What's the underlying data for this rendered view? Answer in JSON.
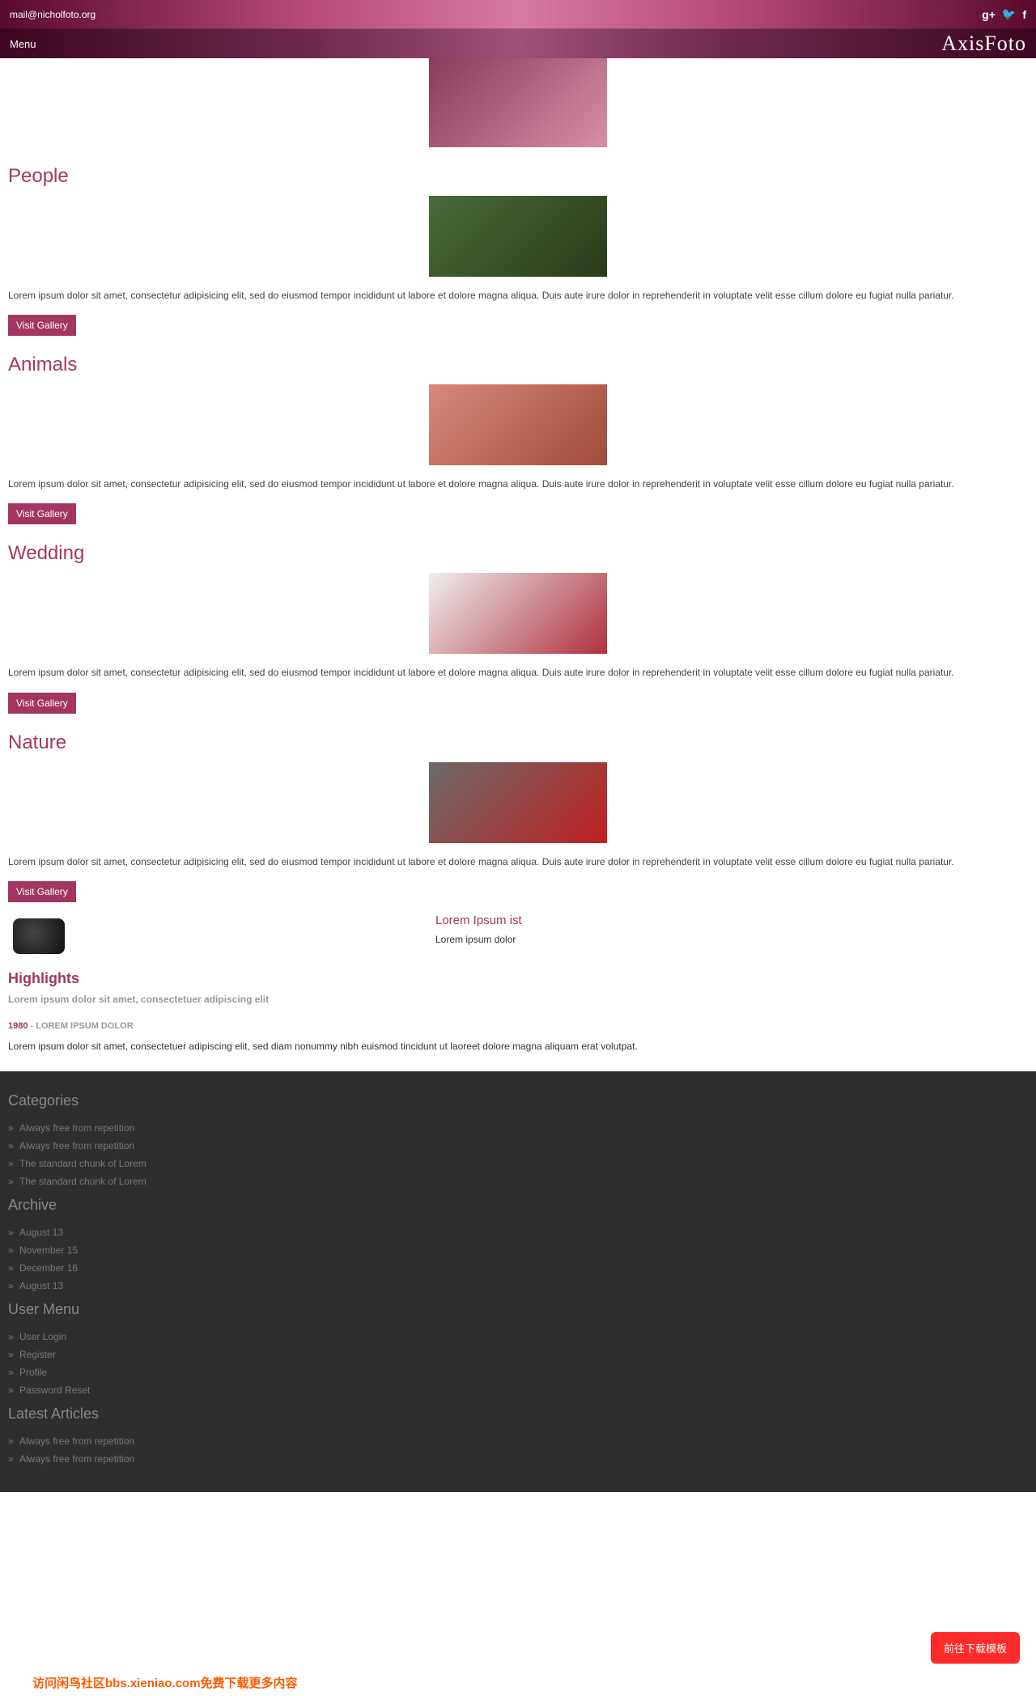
{
  "topbar": {
    "email": "mail@nicholfoto.org",
    "social_google": "g+",
    "social_twitter": "🐦",
    "social_facebook": "f"
  },
  "navbar": {
    "menu_label": "Menu",
    "logo": "AxisFoto"
  },
  "sections": {
    "people": {
      "title": "People",
      "text": "Lorem ipsum dolor sit amet, consectetur adipisicing elit, sed do eiusmod tempor incididunt ut labore et dolore magna aliqua. Duis aute irure dolor in reprehenderit in voluptate velit esse cillum dolore eu fugiat nulla pariatur.",
      "button": "Visit Gallery"
    },
    "animals": {
      "title": "Animals",
      "text": "Lorem ipsum dolor sit amet, consectetur adipisicing elit, sed do eiusmod tempor incididunt ut labore et dolore magna aliqua. Duis aute irure dolor in reprehenderit in voluptate velit esse cillum dolore eu fugiat nulla pariatur.",
      "button": "Visit Gallery"
    },
    "wedding": {
      "title": "Wedding",
      "text": "Lorem ipsum dolor sit amet, consectetur adipisicing elit, sed do eiusmod tempor incididunt ut labore et dolore magna aliqua. Duis aute irure dolor in reprehenderit in voluptate velit esse cillum dolore eu fugiat nulla pariatur.",
      "button": "Visit Gallery"
    },
    "nature": {
      "title": "Nature",
      "text": "Lorem ipsum dolor sit amet, consectetur adipisicing elit, sed do eiusmod tempor incididunt ut labore et dolore magna aliqua. Duis aute irure dolor in reprehenderit in voluptate velit esse cillum dolore eu fugiat nulla pariatur.",
      "button": "Visit Gallery"
    }
  },
  "aside": {
    "title": "Lorem Ipsum ist",
    "text": "Lorem ipsum dolor"
  },
  "highlights": {
    "title": "Highlights",
    "subtitle": "Lorem ipsum dolor sit amet, consectetuer adipiscing elit",
    "year": "1980",
    "label": " - LOREM IPSUM DOLOR",
    "body": "Lorem ipsum dolor sit amet, consectetuer adipiscing elit, sed diam nonummy nibh euismod tincidunt ut laoreet dolore magna aliquam erat volutpat."
  },
  "footer": {
    "categories": {
      "title": "Categories",
      "items": [
        "Always free from repetition",
        "Always free from repetition",
        "The standard chunk of Lorem",
        "The standard chunk of Lorem"
      ]
    },
    "archive": {
      "title": "Archive",
      "items": [
        "August 13",
        "November 15",
        "December 16",
        "August 13"
      ]
    },
    "usermenu": {
      "title": "User Menu",
      "items": [
        "User Login",
        "Register",
        "Profile",
        "Password Reset"
      ]
    },
    "latest": {
      "title": "Latest Articles",
      "items": [
        "Always free from repetition",
        "Always free from repetition"
      ]
    }
  },
  "float_button": "前往下载模板",
  "watermark": "访问闲鸟社区bbs.xieniao.com免费下载更多内容"
}
